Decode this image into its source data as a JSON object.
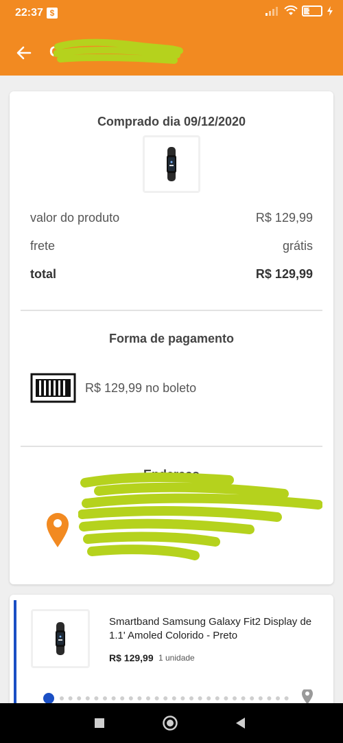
{
  "status_bar": {
    "time": "22:37",
    "notification_icon": "dollar-notification-icon",
    "battery_level": "34",
    "battery_fraction": 0.34,
    "icons": [
      "signal-icon",
      "wifi-icon",
      "battery-icon",
      "charging-icon"
    ]
  },
  "app_bar": {
    "title": "C",
    "back_icon": "arrow-left-icon"
  },
  "summary": {
    "purchased_label": "Comprado dia 09/12/2020",
    "rows": [
      {
        "label": "valor do produto",
        "value": "R$ 129,99"
      },
      {
        "label": "frete",
        "value": "grátis"
      },
      {
        "label": "total",
        "value": "R$ 129,99"
      }
    ],
    "payment_title": "Forma de pagamento",
    "payment_text": "R$ 129,99 no boleto",
    "address_title": "Endereço"
  },
  "item": {
    "name": "Smartband Samsung Galaxy Fit2 Display de 1.1' Amoled Colorido - Preto",
    "price": "R$ 129,99",
    "quantity": "1 unidade"
  },
  "colors": {
    "accent": "#f28a21",
    "tracking_blue": "#1a4fc4",
    "redaction": "#b5d21d"
  },
  "nav_bar": {
    "icons": [
      "recent-apps-icon",
      "home-icon",
      "back-triangle-icon"
    ]
  }
}
